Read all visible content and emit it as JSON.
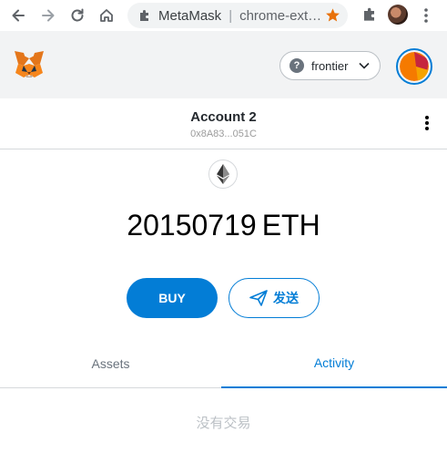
{
  "browser": {
    "site_name": "MetaMask",
    "url": "chrome-ext…",
    "back_icon": "arrow-left-icon",
    "forward_icon": "arrow-right-icon",
    "reload_icon": "reload-icon",
    "home_icon": "home-icon",
    "bookmark_star_color": "#e8710a"
  },
  "header": {
    "network_label": "frontier",
    "accent": "#037dd6"
  },
  "account": {
    "name": "Account 2",
    "address": "0x8A83...051C"
  },
  "balance": {
    "amount": "20150719",
    "unit": "ETH"
  },
  "actions": {
    "buy_label": "BUY",
    "send_label": "发送"
  },
  "tabs": {
    "assets_label": "Assets",
    "activity_label": "Activity",
    "active": "Activity"
  },
  "activity": {
    "empty_text": "没有交易"
  }
}
